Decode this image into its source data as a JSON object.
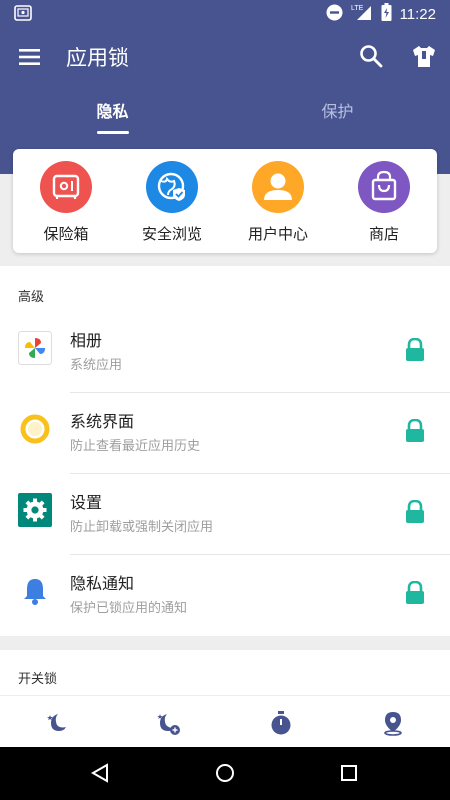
{
  "status_bar": {
    "time": "11:22",
    "network": "LTE"
  },
  "app": {
    "title": "应用锁"
  },
  "tabs": [
    {
      "label": "隐私",
      "active": true
    },
    {
      "label": "保护",
      "active": false
    }
  ],
  "quick_actions": [
    {
      "label": "保险箱",
      "icon": "safe-icon",
      "color": "#ef5350"
    },
    {
      "label": "安全浏览",
      "icon": "globe-shield-icon",
      "color": "#1e88e5"
    },
    {
      "label": "用户中心",
      "icon": "user-icon",
      "color": "#ffa726"
    },
    {
      "label": "商店",
      "icon": "shopping-bag-icon",
      "color": "#7e57c2"
    }
  ],
  "sections": {
    "advanced": {
      "label": "高级",
      "items": [
        {
          "title": "相册",
          "subtitle": "系统应用",
          "icon": "photos-pinwheel-icon"
        },
        {
          "title": "系统界面",
          "subtitle": "防止查看最近应用历史",
          "icon": "ring-icon"
        },
        {
          "title": "设置",
          "subtitle": "防止卸载或强制关闭应用",
          "icon": "gear-icon"
        },
        {
          "title": "隐私通知",
          "subtitle": "保护已锁应用的通知",
          "icon": "bell-icon"
        }
      ]
    },
    "switch_lock": {
      "label": "开关锁"
    }
  },
  "colors": {
    "primary": "#48548f",
    "accent_lock": "#1fb89e",
    "nav_icon": "#48548f"
  }
}
